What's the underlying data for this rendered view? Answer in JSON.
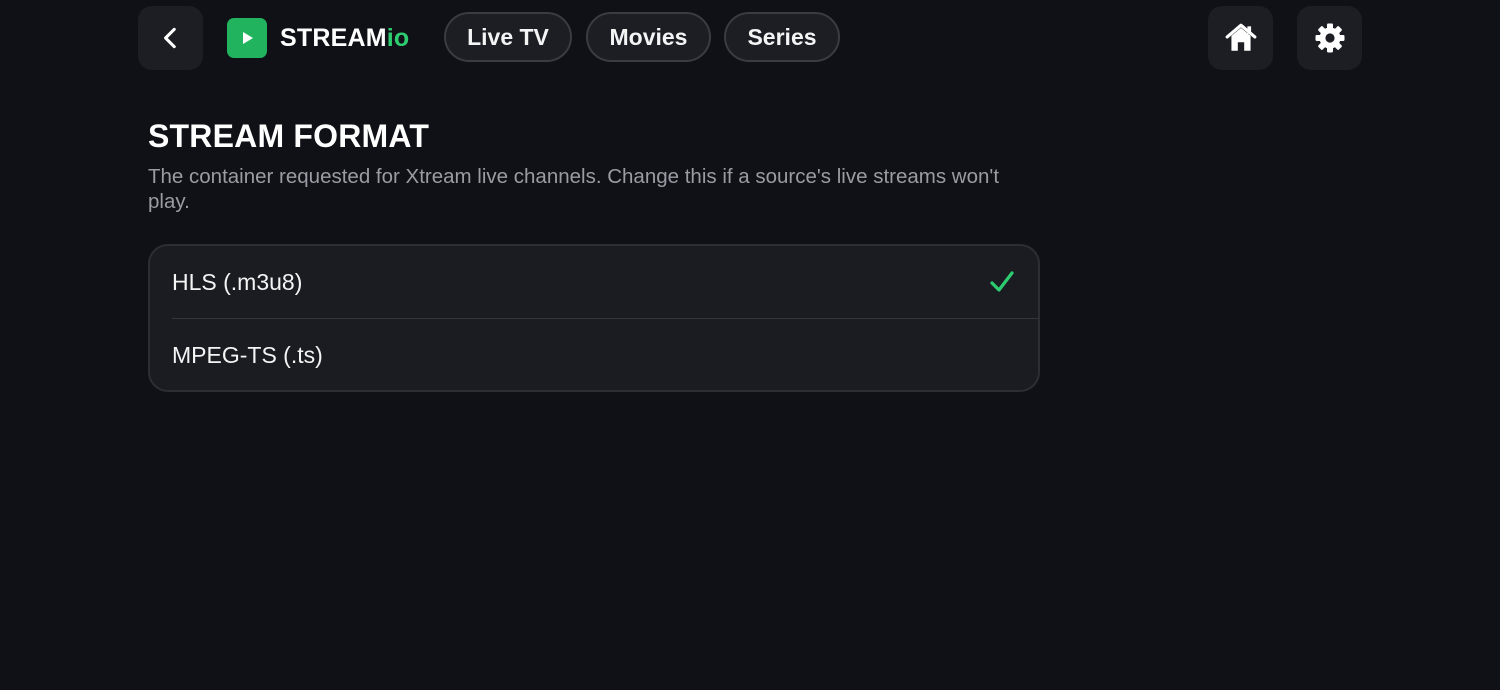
{
  "header": {
    "logo_main": "STREAM",
    "logo_accent": "io",
    "nav": [
      {
        "label": "Live TV"
      },
      {
        "label": "Movies"
      },
      {
        "label": "Series"
      }
    ]
  },
  "section": {
    "title": "STREAM FORMAT",
    "description": "The container requested for Xtream live channels. Change this if a source's live streams won't play."
  },
  "options": [
    {
      "label": "HLS (.m3u8)",
      "selected": true
    },
    {
      "label": "MPEG-TS (.ts)",
      "selected": false
    }
  ],
  "colors": {
    "background": "#0f1116",
    "accent": "#22b35e",
    "check": "#2ecc71",
    "surface": "#1a1c22"
  },
  "icons": {
    "back": "chevron-left-icon",
    "logo": "play-icon",
    "home": "home-icon",
    "settings": "gear-icon",
    "selected": "checkmark-icon"
  }
}
